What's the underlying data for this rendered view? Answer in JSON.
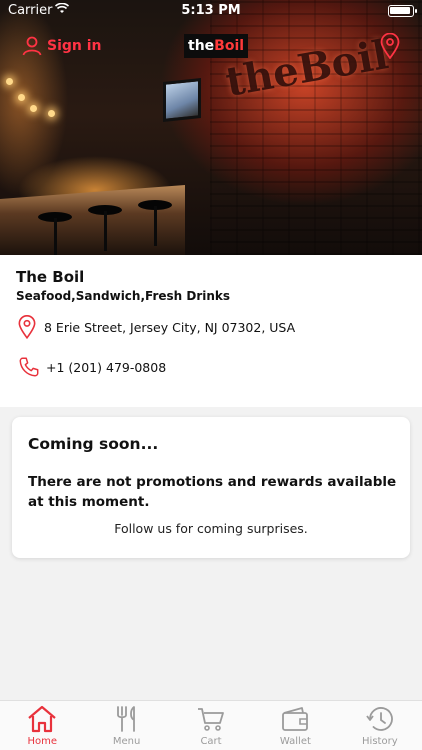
{
  "status_bar": {
    "carrier": "Carrier",
    "time": "5:13 PM"
  },
  "header": {
    "sign_in_label": "Sign in",
    "logo_the": "the",
    "logo_boil": "Boil",
    "wall_sign": "theBoil"
  },
  "restaurant": {
    "name": "The Boil",
    "categories": "Seafood,Sandwich,Fresh Drinks",
    "address": "8 Erie Street, Jersey City, NJ 07302, USA",
    "phone": "+1 (201) 479-0808"
  },
  "promo": {
    "title": "Coming soon...",
    "message": "There are not promotions and rewards available at this moment.",
    "follow": "Follow us for coming surprises."
  },
  "tabs": [
    {
      "label": "Home",
      "icon": "home-icon",
      "active": true
    },
    {
      "label": "Menu",
      "icon": "fork-knife-icon",
      "active": false
    },
    {
      "label": "Cart",
      "icon": "cart-icon",
      "active": false
    },
    {
      "label": "Wallet",
      "icon": "wallet-icon",
      "active": false
    },
    {
      "label": "History",
      "icon": "history-icon",
      "active": false
    }
  ],
  "colors": {
    "accent": "#e8323c",
    "inactive": "#9b9b9b",
    "background": "#f2f2f2"
  }
}
